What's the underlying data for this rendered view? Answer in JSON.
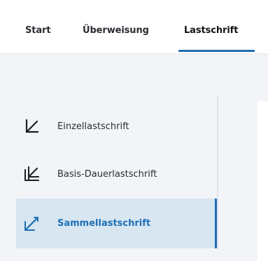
{
  "tabs": {
    "start": "Start",
    "ueberweisung": "Überweisung",
    "lastschrift": "Lastschrift"
  },
  "sidebar": {
    "items": [
      {
        "label": "Einzellastschrift",
        "icon": "single-debit-arrow-icon"
      },
      {
        "label": "Basis-Dauerlastschrift",
        "icon": "recurring-debit-arrows-icon"
      },
      {
        "label": "Sammellastschrift",
        "icon": "batch-debit-arrows-icon",
        "active": true
      }
    ]
  },
  "colors": {
    "accent": "#1f6fb5",
    "active_bg": "#d7e6f1",
    "text": "#2a2e33",
    "content_bg": "#f2f4f7"
  }
}
